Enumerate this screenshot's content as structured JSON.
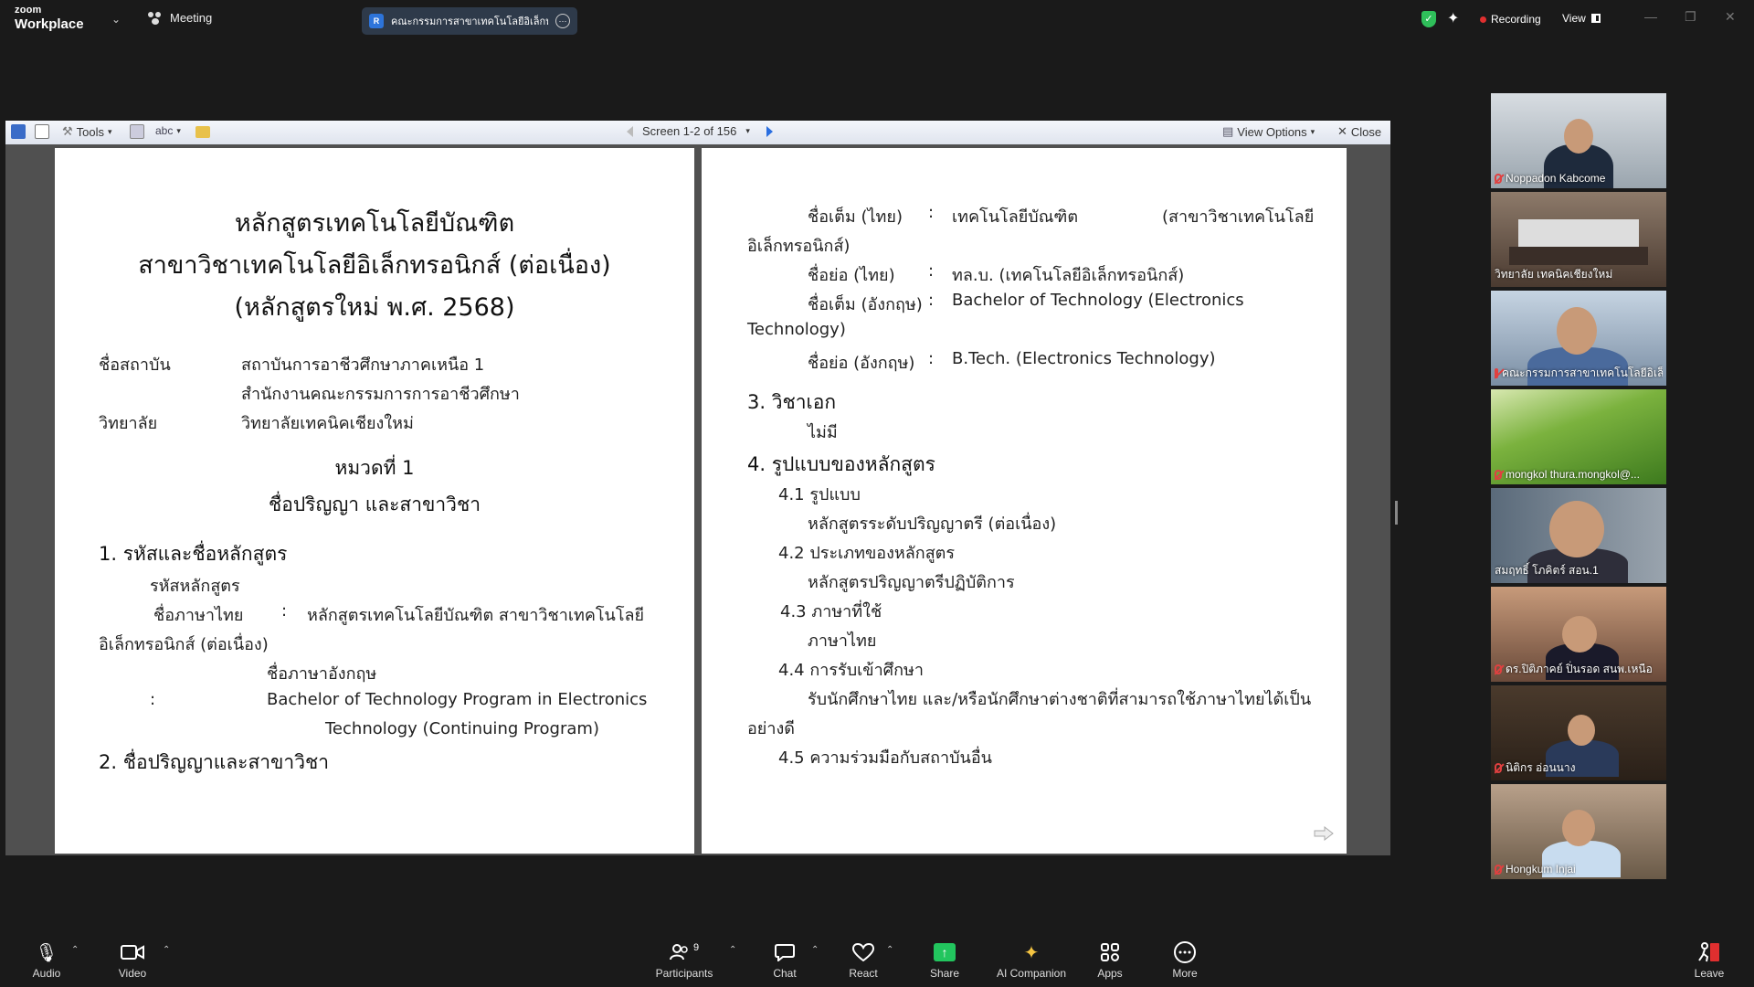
{
  "topbar": {
    "brand_small": "zoom",
    "brand_large": "Workplace",
    "meeting_label": "Meeting",
    "share_tab_badge": "R",
    "share_tab_title": "คณะกรรมการสาขาเทคโนโลยีอิเล็กทรอนิ",
    "recording_label": "Recording",
    "view_label": "View",
    "recording_color": "#e02f2f",
    "shield_color": "#2fbf5a"
  },
  "viewer": {
    "tools_label": "Tools",
    "screen_label": "Screen 1-2 of 156",
    "view_options_label": "View Options",
    "close_label": "Close"
  },
  "doc_left": {
    "title1": "หลักสูตรเทคโนโลยีบัณฑิต",
    "title2": "สาขาวิชาเทคโนโลยีอิเล็กทรอนิกส์ (ต่อเนื่อง)",
    "title3": "(หลักสูตรใหม่ พ.ศ. 2568)",
    "inst_label": "ชื่อสถาบัน",
    "inst_value1": "สถาบันการอาชีวศึกษาภาคเหนือ 1",
    "inst_value2": "สำนักงานคณะกรรมการการอาชีวศึกษา",
    "college_label": "วิทยาลัย",
    "college_value": "วิทยาลัยเทคนิคเชียงใหม่",
    "chapter": "หมวดที่   1",
    "chapter_title": "ชื่อปริญญา และสาขาวิชา",
    "s1": "1.   รหัสและชื่อหลักสูตร",
    "s1_code": "รหัสหลักสูตร",
    "s1_thai_label": "ชื่อภาษาไทย",
    "colon": ":",
    "s1_thai_value": "หลักสูตรเทคโนโลยีบัณฑิต  สาขาวิชาเทคโนโลยี",
    "s1_thai_cont": "อิเล็กทรอนิกส์ (ต่อเนื่อง)",
    "s1_eng_label": "ชื่อภาษาอังกฤษ",
    "s1_eng_value1": "Bachelor of Technology Program in Electronics",
    "s1_eng_value2": "Technology (Continuing Program)",
    "s2": "2.   ชื่อปริญญาและสาขาวิชา"
  },
  "doc_right": {
    "full_th_label": "ชื่อเต็ม (ไทย)",
    "full_th_value": "เทคโนโลยีบัณฑิต",
    "full_th_extra": "(สาขาวิชาเทคโนโลยี",
    "full_th_cont": "อิเล็กทรอนิกส์)",
    "abbr_th_label": "ชื่อย่อ (ไทย)",
    "abbr_th_value": "ทล.บ. (เทคโนโลยีอิเล็กทรอนิกส์)",
    "full_en_label": "ชื่อเต็ม (อังกฤษ)",
    "full_en_value": "Bachelor    of    Technology    (Electronics",
    "full_en_cont": "Technology)",
    "abbr_en_label": "ชื่อย่อ (อังกฤษ)",
    "abbr_en_value": "B.Tech.  (Electronics Technology)",
    "colon": ":",
    "s3": "3.  วิชาเอก",
    "s3_value": "ไม่มี",
    "s4": "4.  รูปแบบของหลักสูตร",
    "s41": "4.1  รูปแบบ",
    "s41_value": "หลักสูตรระดับปริญญาตรี (ต่อเนื่อง)",
    "s42": "4.2 ประเภทของหลักสูตร",
    "s42_value": "หลักสูตรปริญญาตรีปฏิบัติการ",
    "s43": "4.3  ภาษาที่ใช้",
    "s43_value": "ภาษาไทย",
    "s44": "4.4  การรับเข้าศึกษา",
    "s44_value": "รับนักศึกษาไทย และ/หรือนักศึกษาต่างชาติที่สามารถใช้ภาษาไทยได้เป็น",
    "s44_cont": "อย่างดี",
    "s45": "4.5   ความร่วมมือกับสถาบันอื่น"
  },
  "participants": [
    {
      "name": "Noppadon Kabcome",
      "bg": "#b9c2cc",
      "muted": true
    },
    {
      "name": "วิทยาลัย เทคนิคเชียงใหม่",
      "bg": "#6f5a4a",
      "muted": false
    },
    {
      "name": "คณะกรรมการสาขาเทคโนโลยีอิเล็...",
      "bg": "#9fb4c8",
      "muted": true
    },
    {
      "name": "mongkol thura.mongkol@...",
      "bg": "#6fa83a",
      "muted": true
    },
    {
      "name": "สมฤทธิ์ โภคิตร์ สอน.1",
      "bg": "#7a7f86",
      "muted": false
    },
    {
      "name": "ดร.ปิติภาคย์ ปิ่นรอด สนพ.เหนือ",
      "bg": "#8a6b55",
      "muted": true
    },
    {
      "name": "นิติกร อ่อนนาง",
      "bg": "#5a4a3a",
      "muted": true
    },
    {
      "name": "Hongkum Injai",
      "bg": "#8c7a66",
      "muted": true
    }
  ],
  "bottombar": {
    "audio": "Audio",
    "video": "Video",
    "participants": "Participants",
    "participants_count": "9",
    "chat": "Chat",
    "react": "React",
    "share": "Share",
    "ai": "AI Companion",
    "apps": "Apps",
    "more": "More",
    "leave": "Leave",
    "share_color": "#22c55e",
    "leave_color": "#e02f2f"
  }
}
